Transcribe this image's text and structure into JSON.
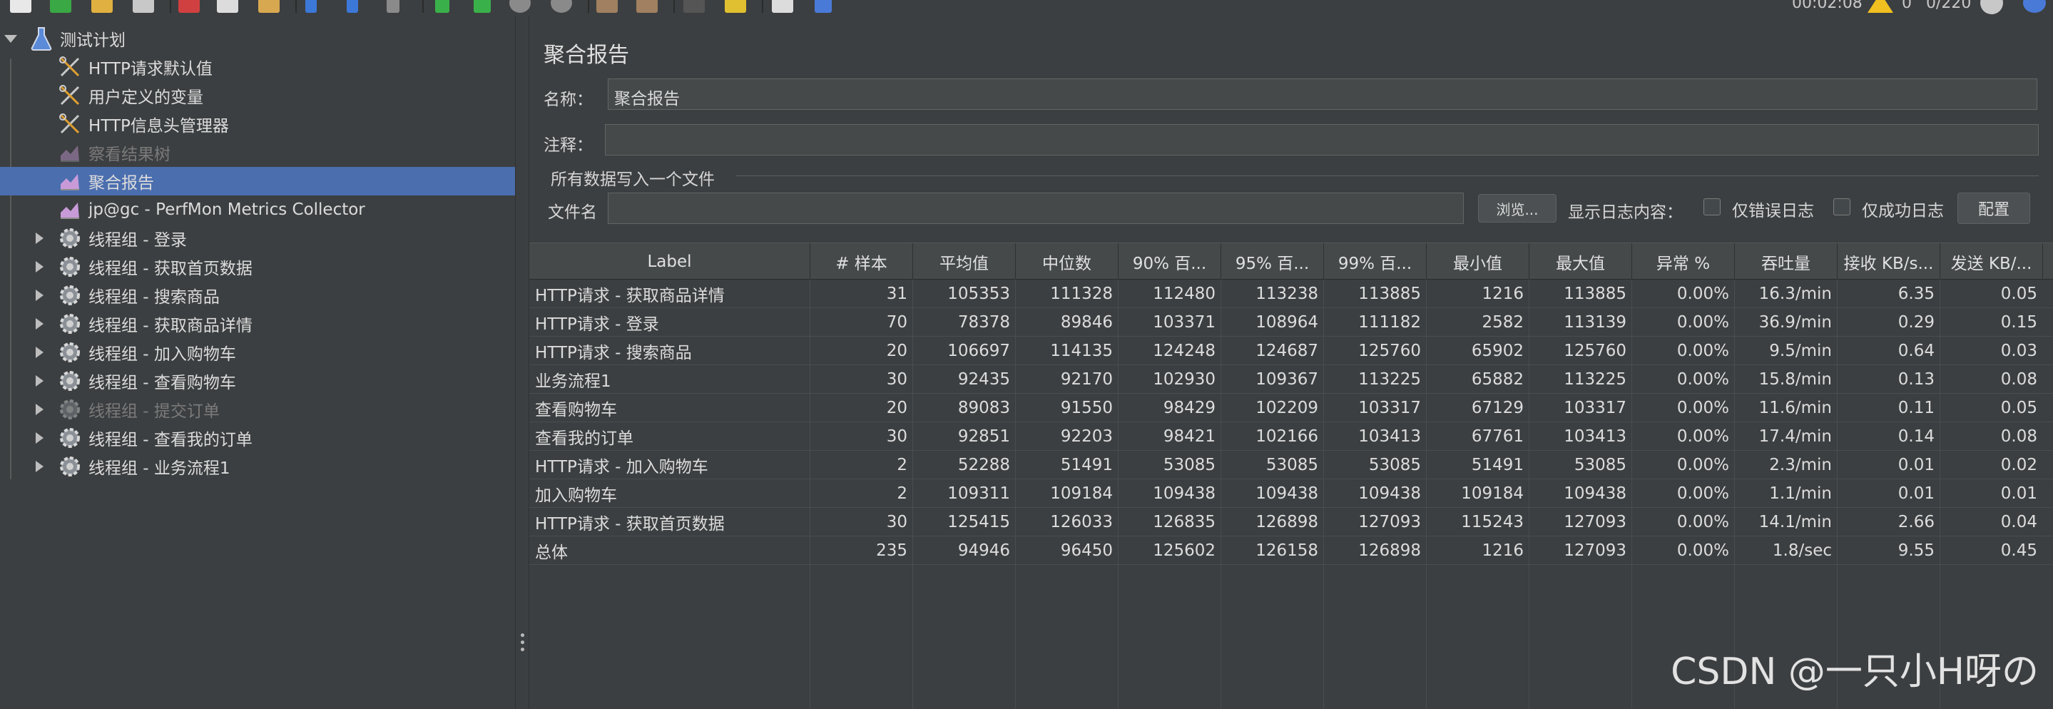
{
  "toolbar": {
    "timer": "00:02:08",
    "warning_count": "0",
    "thread_count": "0/220"
  },
  "tree": {
    "root": "测试计划",
    "items": [
      {
        "label": "HTTP请求默认值",
        "icon": "wrench-scissors-icon",
        "disabled": false
      },
      {
        "label": "用户定义的变量",
        "icon": "wrench-scissors-icon",
        "disabled": false
      },
      {
        "label": "HTTP信息头管理器",
        "icon": "wrench-scissors-icon",
        "disabled": false
      },
      {
        "label": "察看结果树",
        "icon": "chart-icon",
        "disabled": true
      },
      {
        "label": "聚合报告",
        "icon": "chart-icon",
        "disabled": false,
        "selected": true
      },
      {
        "label": "jp@gc - PerfMon Metrics Collector",
        "icon": "chart-icon",
        "disabled": false
      },
      {
        "label": "线程组 - 登录",
        "icon": "gear-icon",
        "disabled": false
      },
      {
        "label": "线程组 - 获取首页数据",
        "icon": "gear-icon",
        "disabled": false
      },
      {
        "label": "线程组 - 搜索商品",
        "icon": "gear-icon",
        "disabled": false
      },
      {
        "label": "线程组 - 获取商品详情",
        "icon": "gear-icon",
        "disabled": false
      },
      {
        "label": "线程组 - 加入购物车",
        "icon": "gear-icon",
        "disabled": false
      },
      {
        "label": "线程组 - 查看购物车",
        "icon": "gear-icon",
        "disabled": false
      },
      {
        "label": "线程组 - 提交订单",
        "icon": "gear-icon",
        "disabled": true
      },
      {
        "label": "线程组 - 查看我的订单",
        "icon": "gear-icon",
        "disabled": false
      },
      {
        "label": "线程组 - 业务流程1",
        "icon": "gear-icon",
        "disabled": false
      }
    ]
  },
  "panel": {
    "title": "聚合报告",
    "name_label": "名称：",
    "name_value": "聚合报告",
    "comment_label": "注释：",
    "comment_value": "",
    "group_title": "所有数据写入一个文件",
    "filename_label": "文件名",
    "filename_value": "",
    "browse_button": "浏览...",
    "log_label": "显示日志内容：",
    "errors_only": "仅错误日志",
    "success_only": "仅成功日志",
    "config_button": "配置"
  },
  "table": {
    "headers": [
      "Label",
      "# 样本",
      "平均值",
      "中位数",
      "90% 百...",
      "95% 百...",
      "99% 百...",
      "最小值",
      "最大值",
      "异常 %",
      "吞吐量",
      "接收 KB/s...",
      "发送 KB/..."
    ],
    "rows": [
      [
        "HTTP请求 - 获取商品详情",
        "31",
        "105353",
        "111328",
        "112480",
        "113238",
        "113885",
        "1216",
        "113885",
        "0.00%",
        "16.3/min",
        "6.35",
        "0.05"
      ],
      [
        "HTTP请求 - 登录",
        "70",
        "78378",
        "89846",
        "103371",
        "108964",
        "111182",
        "2582",
        "113139",
        "0.00%",
        "36.9/min",
        "0.29",
        "0.15"
      ],
      [
        "HTTP请求 - 搜索商品",
        "20",
        "106697",
        "114135",
        "124248",
        "124687",
        "125760",
        "65902",
        "125760",
        "0.00%",
        "9.5/min",
        "0.64",
        "0.03"
      ],
      [
        "业务流程1",
        "30",
        "92435",
        "92170",
        "102930",
        "109367",
        "113225",
        "65882",
        "113225",
        "0.00%",
        "15.8/min",
        "0.13",
        "0.08"
      ],
      [
        "查看购物车",
        "20",
        "89083",
        "91550",
        "98429",
        "102209",
        "103317",
        "67129",
        "103317",
        "0.00%",
        "11.6/min",
        "0.11",
        "0.05"
      ],
      [
        "查看我的订单",
        "30",
        "92851",
        "92203",
        "98421",
        "102166",
        "103413",
        "67761",
        "103413",
        "0.00%",
        "17.4/min",
        "0.14",
        "0.08"
      ],
      [
        "HTTP请求 - 加入购物车",
        "2",
        "52288",
        "51491",
        "53085",
        "53085",
        "53085",
        "51491",
        "53085",
        "0.00%",
        "2.3/min",
        "0.01",
        "0.02"
      ],
      [
        "加入购物车",
        "2",
        "109311",
        "109184",
        "109438",
        "109438",
        "109438",
        "109184",
        "109438",
        "0.00%",
        "1.1/min",
        "0.01",
        "0.01"
      ],
      [
        "HTTP请求 - 获取首页数据",
        "30",
        "125415",
        "126033",
        "126835",
        "126898",
        "127093",
        "115243",
        "127093",
        "0.00%",
        "14.1/min",
        "2.66",
        "0.04"
      ],
      [
        "总体",
        "235",
        "94946",
        "96450",
        "125602",
        "126158",
        "126898",
        "1216",
        "127093",
        "0.00%",
        "1.8/sec",
        "9.55",
        "0.45"
      ]
    ]
  },
  "watermark": "CSDN @一只小H呀の"
}
